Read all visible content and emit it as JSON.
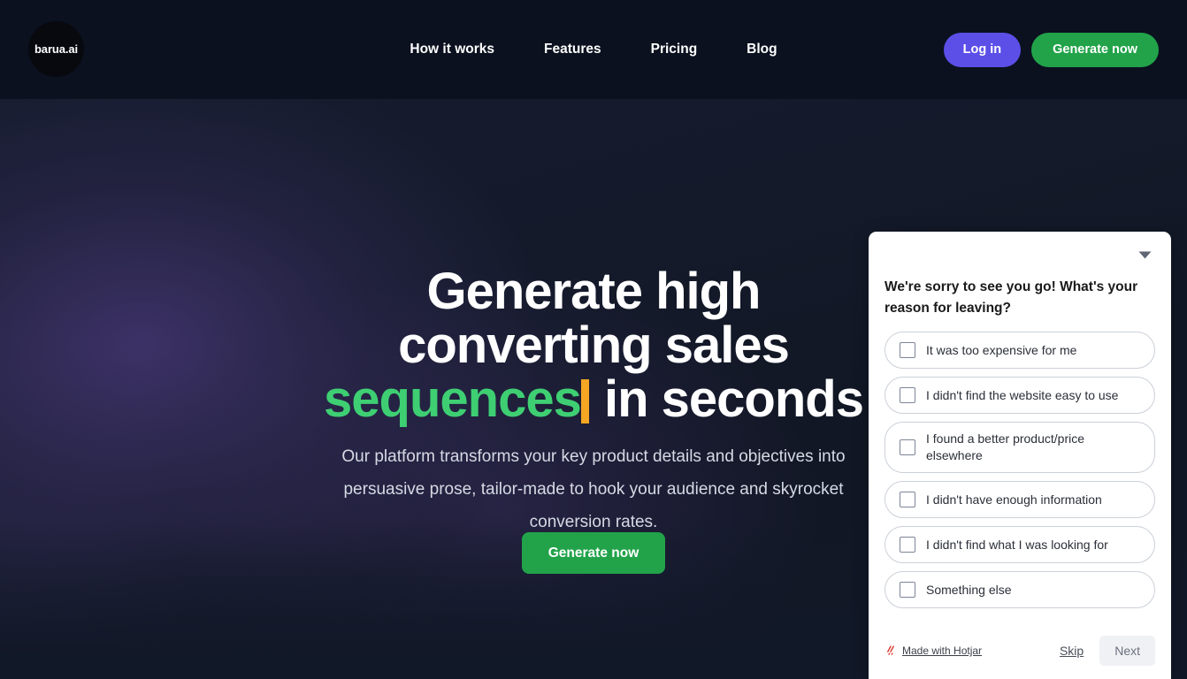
{
  "header": {
    "logo_text": "barua.ai",
    "nav_items": [
      {
        "label": "How it works"
      },
      {
        "label": "Features"
      },
      {
        "label": "Pricing"
      },
      {
        "label": "Blog"
      }
    ],
    "login_label": "Log in",
    "generate_label": "Generate now"
  },
  "hero": {
    "headline_line1": "Generate high",
    "headline_line2": "converting sales",
    "headline_highlight": "sequences",
    "headline_tail": " in seconds",
    "subtitle": "Our platform transforms your key product details and objectives into persuasive prose, tailor-made to hook your audience and skyrocket conversion rates.",
    "cta_label": "Generate now"
  },
  "survey": {
    "question": "We're sorry to see you go! What's your reason for leaving?",
    "collapse_icon": "chevron-down-icon",
    "options": [
      {
        "label": "It was too expensive for me",
        "checked": false
      },
      {
        "label": "I didn't find the website easy to use",
        "checked": false
      },
      {
        "label": "I found a better product/price elsewhere",
        "checked": false
      },
      {
        "label": "I didn't have enough information",
        "checked": false
      },
      {
        "label": "I didn't find what I was looking for",
        "checked": false
      },
      {
        "label": "Something else",
        "checked": false
      }
    ],
    "brand_text": "Made with Hotjar",
    "brand_icon": "hotjar-flame-icon",
    "skip_label": "Skip",
    "next_label": "Next"
  },
  "colors": {
    "accent_green": "#22A34A",
    "accent_purple": "#5B4FE8",
    "highlight_green": "#3ECF73",
    "cursor_orange": "#F5A623",
    "page_bg": "#111827",
    "header_bg": "#0B111F",
    "hotjar_red": "#D9382B"
  }
}
